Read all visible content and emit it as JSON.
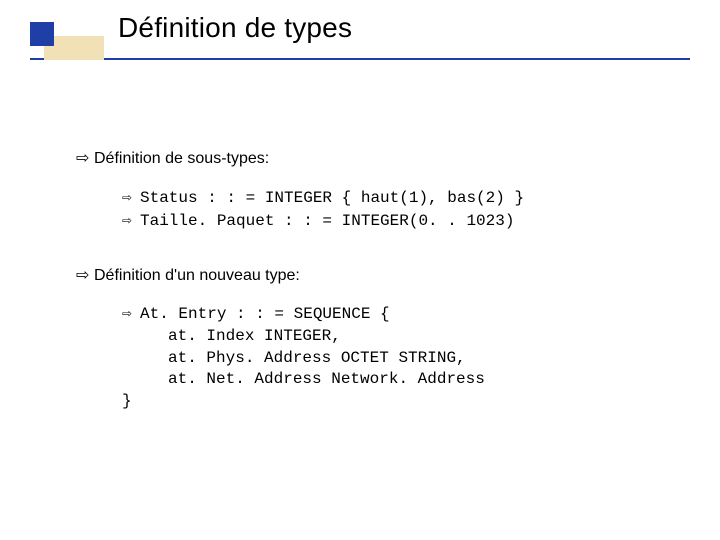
{
  "title": "Définition de types",
  "section1": {
    "heading": "Définition de sous-types:",
    "items": [
      "Status : : = INTEGER { haut(1), bas(2) }",
      "Taille. Paquet : : = INTEGER(0. . 1023)"
    ]
  },
  "section2": {
    "heading": "Définition d'un nouveau type:",
    "lead": "At. Entry : : = SEQUENCE {",
    "fields": [
      "at. Index INTEGER,",
      "at. Phys. Address OCTET STRING,",
      "at. Net. Address Network. Address"
    ],
    "close": "}"
  },
  "bullet_glyph": "⇨"
}
